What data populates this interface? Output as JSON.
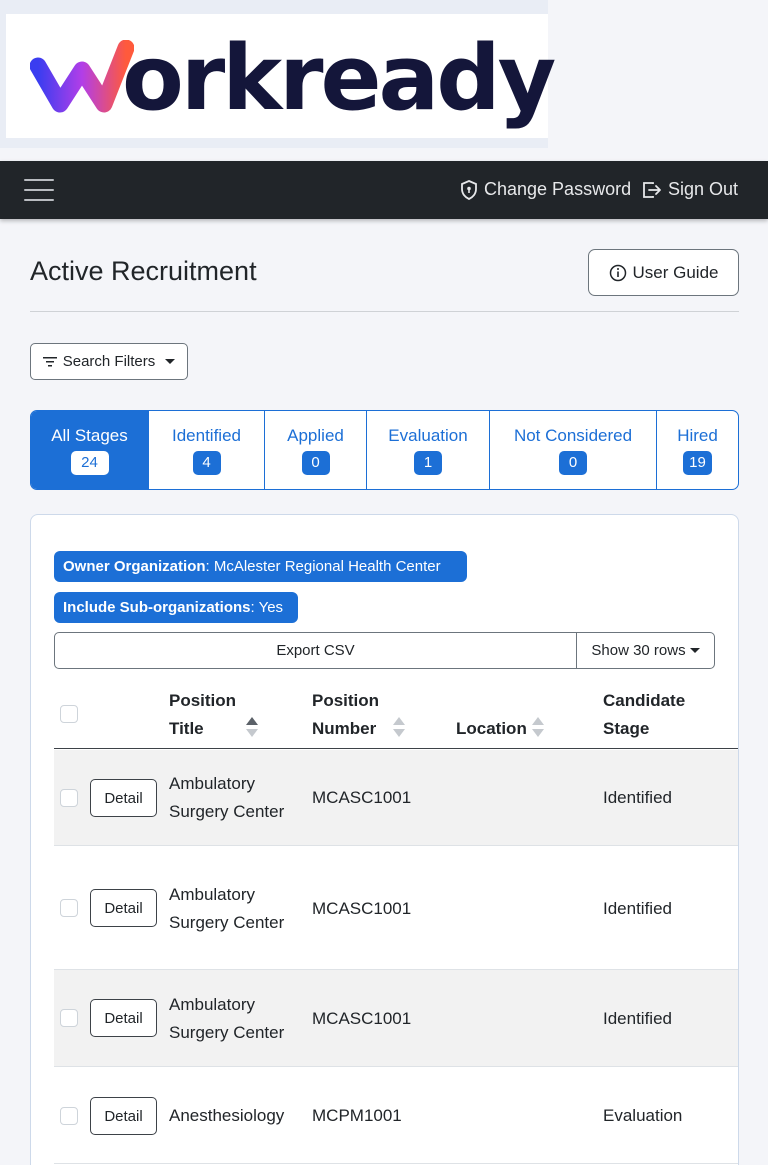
{
  "brand": {
    "name": "orkready"
  },
  "nav": {
    "change_password": "Change Password",
    "sign_out": "Sign Out"
  },
  "page": {
    "title": "Active Recruitment",
    "user_guide": "User Guide",
    "search_filters": "Search Filters"
  },
  "stages": [
    {
      "label": "All Stages",
      "count": "24"
    },
    {
      "label": "Identified",
      "count": "4"
    },
    {
      "label": "Applied",
      "count": "0"
    },
    {
      "label": "Evaluation",
      "count": "1"
    },
    {
      "label": "Not Considered",
      "count": "0"
    },
    {
      "label": "Hired",
      "count": "19"
    }
  ],
  "filters": {
    "owner_label": "Owner Organization",
    "owner_value": ": McAlester Regional Health Center",
    "sub_label": "Include Sub-organizations",
    "sub_value": ": Yes"
  },
  "toolbar": {
    "export": "Export CSV",
    "rows": "Show 30 rows"
  },
  "table": {
    "headers": {
      "title_line1": "Position",
      "title_line2": "Title",
      "number_line1": "Position",
      "number_line2": "Number",
      "location": "Location",
      "stage_line1": "Candidate",
      "stage_line2": "Stage"
    },
    "detail_label": "Detail",
    "rows": [
      {
        "title_line1": "Ambulatory",
        "title_line2": "Surgery Center",
        "number": "MCASC1001",
        "location": "",
        "stage": "Identified"
      },
      {
        "title_line1": "Ambulatory",
        "title_line2": "Surgery Center",
        "number": "MCASC1001",
        "location": "",
        "stage": "Identified"
      },
      {
        "title_line1": "Ambulatory",
        "title_line2": "Surgery Center",
        "number": "MCASC1001",
        "location": "",
        "stage": "Identified"
      },
      {
        "title_line1": "Anesthesiology",
        "title_line2": "",
        "number": "MCPM1001",
        "location": "",
        "stage": "Evaluation"
      }
    ]
  }
}
